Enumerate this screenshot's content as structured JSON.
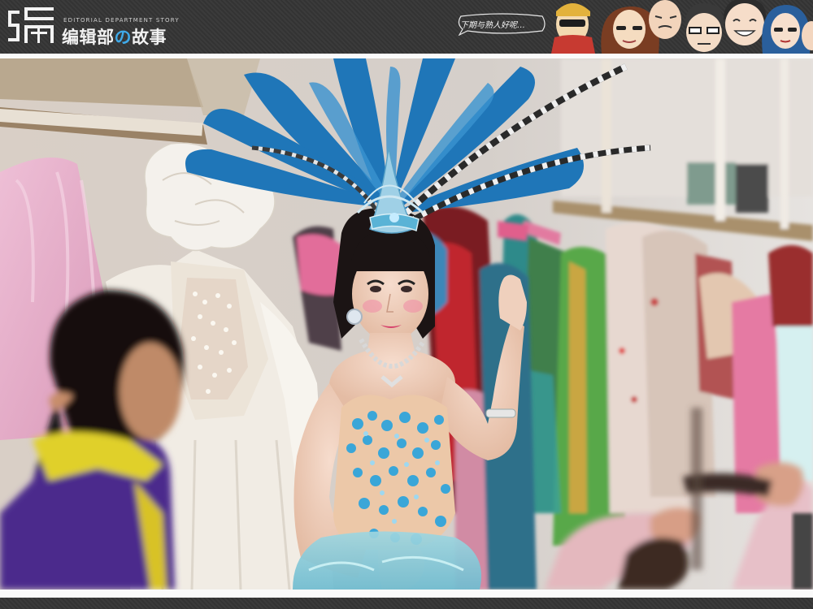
{
  "header": {
    "brand_en": "EDITORIAL DEPARTMENT STORY",
    "brand_cn_part1": "编辑部",
    "brand_cn_connector": "の",
    "brand_cn_part2": "故事",
    "bubble_text": "下期与熟人好呢…",
    "accent_color": "#3fa9e8",
    "logo_icon": "square-stamp-logo-icon",
    "characters_icon": "cartoon-staff-faces-icon"
  },
  "photo": {
    "subject": "photograph"
  },
  "colors": {
    "frame_dark": "#353535",
    "frame_light": "#fafafa",
    "feathers": "#1f76b8",
    "dress_sequins": "#4ba3d6",
    "jacket_purple": "#4c2b8c",
    "jacket_yellow": "#e0d02a"
  }
}
